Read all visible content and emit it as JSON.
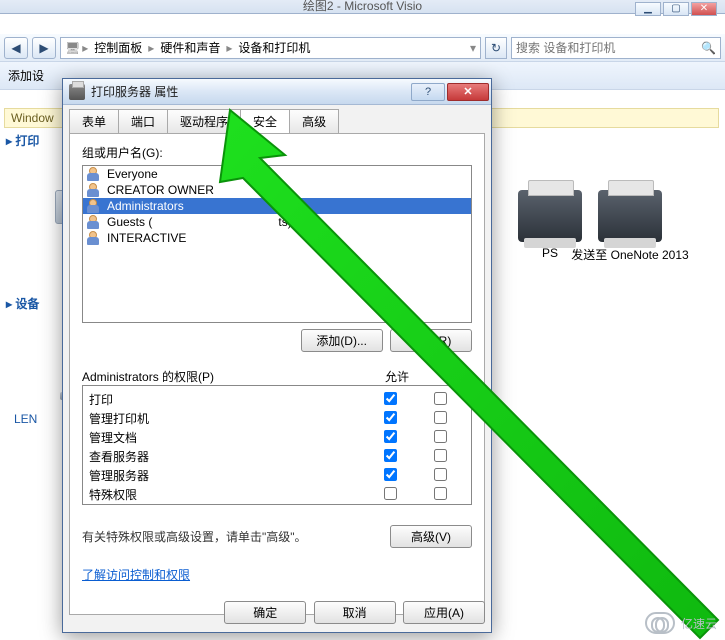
{
  "visio": {
    "title": "绘图2 - Microsoft Visio"
  },
  "explorer": {
    "breadcrumb": [
      "控制面板",
      "硬件和声音",
      "设备和打印机"
    ],
    "search_placeholder": "搜索 设备和打印机",
    "cmdbar_add": "添加设",
    "infobar_label": "Window",
    "tree": {
      "printers_head": "▸ 打印",
      "devices_head": "▸ 设备",
      "item_len": "LEN"
    },
    "printers": {
      "xps_suffix": "PS",
      "onenote": "发送至 OneNote 2013"
    }
  },
  "dialog": {
    "title": "打印服务器 属性",
    "tabs": [
      "表单",
      "端口",
      "驱动程序",
      "安全",
      "高级"
    ],
    "active_tab": 3,
    "group_label": "组或用户名(G):",
    "users": [
      {
        "name": "Everyone",
        "type": "group"
      },
      {
        "name": "CREATOR OWNER",
        "type": "group"
      },
      {
        "name": "Administrators",
        "suffix": "",
        "type": "group",
        "selected": true
      },
      {
        "name": "Guests (",
        "suffix": "ts)",
        "type": "group"
      },
      {
        "name": "INTERACTIVE",
        "type": "group"
      }
    ],
    "buttons": {
      "add": "添加(D)...",
      "remove": "删除(R)",
      "advanced": "高级(V)",
      "ok": "确定",
      "cancel": "取消",
      "apply": "应用(A)"
    },
    "perm_header": {
      "title": "Administrators 的权限(P)",
      "allow": "允许"
    },
    "permissions": [
      {
        "label": "打印",
        "allow": true,
        "deny": false
      },
      {
        "label": "管理打印机",
        "allow": true,
        "deny": false
      },
      {
        "label": "管理文档",
        "allow": true,
        "deny": false
      },
      {
        "label": "查看服务器",
        "allow": true,
        "deny": false
      },
      {
        "label": "管理服务器",
        "allow": true,
        "deny": false
      },
      {
        "label": "特殊权限",
        "allow": false,
        "deny": false
      }
    ],
    "advanced_text": "有关特殊权限或高级设置，请单击\"高级\"。",
    "learn_link": "了解访问控制和权限"
  },
  "watermark": "亿速云"
}
